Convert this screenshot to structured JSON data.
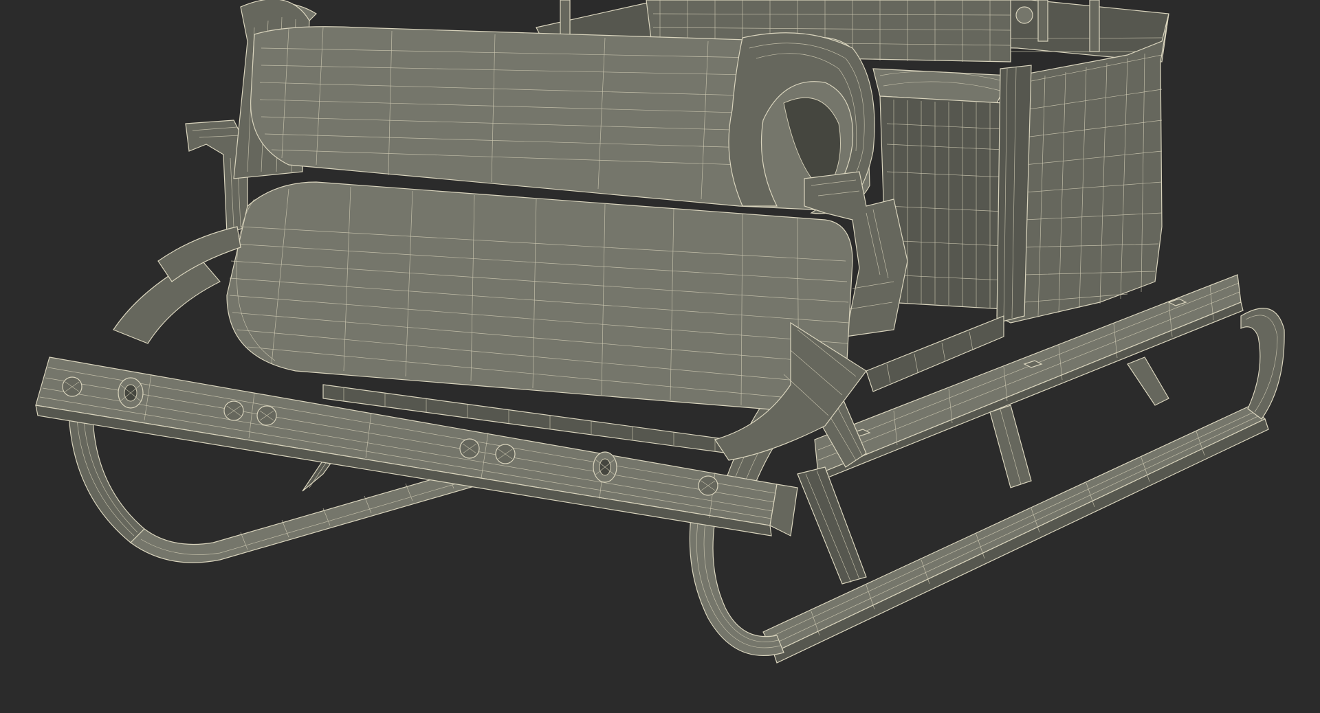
{
  "viewport": {
    "background_color": "#2b2b2b",
    "mesh_fill_colors": [
      "#56574f",
      "#66675d",
      "#75766b"
    ],
    "wire_color": "#d9d4bd"
  },
  "scene": {
    "subject": "sleigh-wireframe-render",
    "parts": [
      {
        "name": "backrest-bolster-roll"
      },
      {
        "name": "seat-roll-cushion"
      },
      {
        "name": "front-crossbar-with-bolts"
      },
      {
        "name": "left-runner"
      },
      {
        "name": "right-runner"
      },
      {
        "name": "right-side-panel"
      },
      {
        "name": "rear-seat-cushion"
      },
      {
        "name": "right-crossbar"
      },
      {
        "name": "left-armrest-scroll"
      },
      {
        "name": "right-armrest-scroll"
      }
    ]
  }
}
